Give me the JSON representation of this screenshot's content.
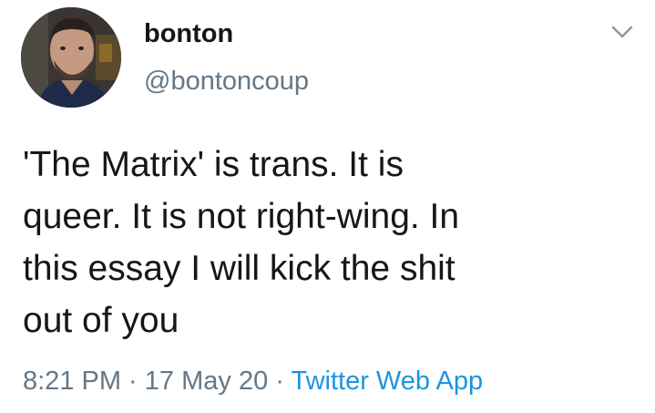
{
  "user": {
    "display_name": "bonton",
    "handle": "@bontoncoup"
  },
  "tweet": {
    "lines": [
      "'The Matrix' is trans. It is",
      "queer. It is not right-wing. In",
      "this essay I will kick the shit",
      "out of you"
    ]
  },
  "meta": {
    "time": "8:21 PM",
    "separator": " · ",
    "date": "17 May 20",
    "source": "Twitter Web App"
  },
  "icons": {
    "caret": "chevron-down-icon",
    "avatar": "user-avatar"
  },
  "colors": {
    "text": "#14171a",
    "secondary": "#657786",
    "link": "#1b95e0"
  }
}
